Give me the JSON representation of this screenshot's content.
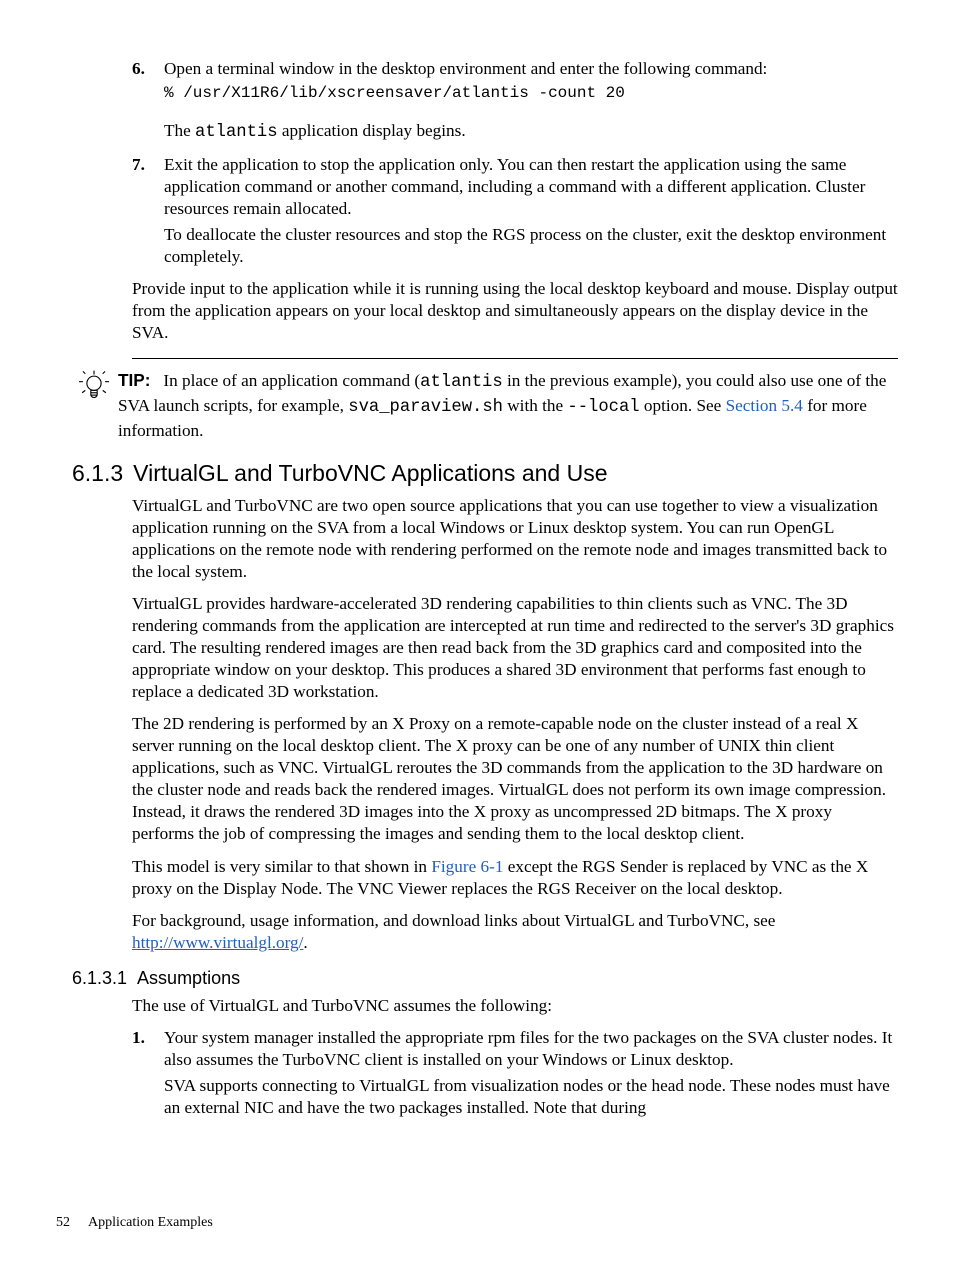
{
  "steps": {
    "s6": {
      "num": "6.",
      "text_parts": [
        "Open a terminal window in the desktop environment and enter the following command:"
      ],
      "code": "% /usr/X11R6/lib/xscreensaver/atlantis -count 20",
      "after_parts": [
        "The ",
        "atlantis",
        " application display begins."
      ]
    },
    "s7": {
      "num": "7.",
      "text": "Exit the application to stop the application only. You can then restart the application using the same application command or another command, including a command with a different application. Cluster resources remain allocated.",
      "sub": "To deallocate the cluster resources and stop the RGS process on the cluster, exit the desktop environment completely."
    }
  },
  "post_steps": "Provide input to the application while it is running using the local desktop keyboard and mouse. Display output from the application appears on your local desktop and simultaneously appears on the display device in the SVA.",
  "tip": {
    "label": "TIP:",
    "seg1": "In place of an application command (",
    "mono1": "atlantis",
    "seg2": " in the previous example), you could also use one of the SVA launch scripts, for example, ",
    "mono2": "sva_paraview.sh",
    "seg3": " with the ",
    "mono3": "--local",
    "seg4": " option. See ",
    "link": "Section 5.4",
    "seg5": " for more information."
  },
  "sec613": {
    "num": "6.1.3",
    "title": "VirtualGL and TurboVNC Applications and Use",
    "p1": "VirtualGL and TurboVNC are two open source applications that you can use together to view a visualization application running on the SVA from a local Windows or Linux desktop system. You can run OpenGL applications on the remote node with rendering performed on the remote node and images transmitted back to the local system.",
    "p2": "VirtualGL provides hardware-accelerated 3D rendering capabilities to thin clients such as VNC. The 3D rendering commands from the application are intercepted at run time and redirected to the server's 3D graphics card. The resulting rendered images are then read back from the 3D graphics card and composited into the appropriate window on your desktop. This produces a shared 3D environment that performs fast enough to replace a dedicated 3D workstation.",
    "p3": "The 2D rendering is performed by an X Proxy on a remote-capable node on the cluster instead of a real X server running on the local desktop client. The X proxy can be one of any number of UNIX thin client applications, such as VNC. VirtualGL reroutes the 3D commands from the application to the 3D hardware on the cluster node and reads back the rendered images. VirtualGL does not perform its own image compression. Instead, it draws the rendered 3D images into the X proxy as uncompressed 2D bitmaps. The X proxy performs the job of compressing the images and sending them to the local desktop client.",
    "p4a": "This model is very similar to that shown in ",
    "p4_link": "Figure 6-1",
    "p4b": " except the RGS Sender is replaced by VNC as the X proxy on the Display Node. The VNC Viewer replaces the RGS Receiver on the local desktop.",
    "p5a": "For background, usage information, and download links about VirtualGL and TurboVNC, see ",
    "p5_link": "http://www.virtualgl.org/",
    "p5b": "."
  },
  "sec6131": {
    "num": "6.1.3.1",
    "title": "Assumptions",
    "intro": "The use of VirtualGL and TurboVNC assumes the following:",
    "li1": {
      "num": "1.",
      "text": "Your system manager installed the appropriate rpm files for the two packages on the SVA cluster nodes. It also assumes the TurboVNC client is installed on your Windows or Linux desktop.",
      "sub": "SVA supports connecting to VirtualGL from visualization nodes or the head node. These nodes must have an external NIC and have the two packages installed. Note that during"
    }
  },
  "footer": {
    "page": "52",
    "section": "Application Examples"
  }
}
